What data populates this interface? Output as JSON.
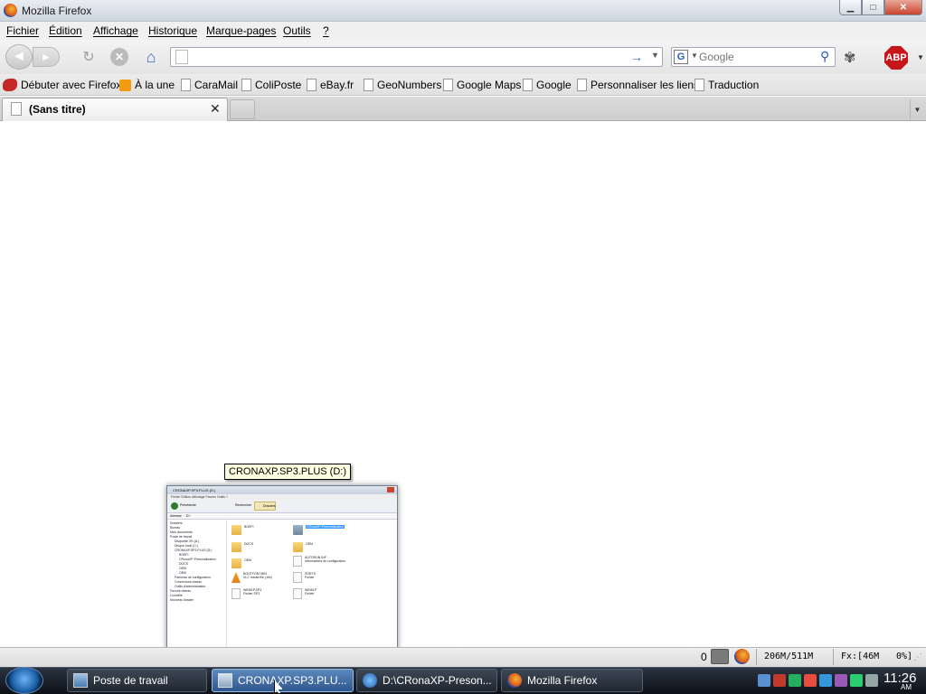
{
  "window": {
    "title": "Mozilla Firefox"
  },
  "menu": [
    "Fichier",
    "Édition",
    "Affichage",
    "Historique",
    "Marque-pages",
    "Outils",
    "?"
  ],
  "navbar": {
    "url": "",
    "search_placeholder": "Google",
    "adblock_label": "ABP"
  },
  "bookmarks": [
    "Débuter avec Firefox",
    "À la une",
    "CaraMail",
    "ColiPoste",
    "eBay.fr",
    "GeoNumbers",
    "Google Maps",
    "Google",
    "Personnaliser les liens",
    "Traduction"
  ],
  "tabs": [
    {
      "title": "(Sans titre)"
    }
  ],
  "tooltip": "CRONAXP.SP3.PLUS (D:)",
  "thumbnail": {
    "title": "CRONAXP.SP3.PLUS (D:)",
    "menu": "Fichier   Edition   Affichage   Favoris   Outils   ?",
    "address_label": "Adresse",
    "address_value": "D:\\",
    "toolbar_back": "Précédente",
    "toolbar_search": "Rechercher",
    "toolbar_folders": "Dossiers",
    "tree": [
      "Dossiers",
      "Bureau",
      "Mes documents",
      "Poste de travail",
      "Disquette 3½ (A:)",
      "Disque local (C:)",
      "CRONAXP.SP3.PLUS (D:)",
      "BOEFI",
      "CRonaXP-Presonalisation",
      "DOCS",
      "OEM",
      "OEM",
      "Panneau de configuration",
      "Connexions réseau",
      "Outils d'administration",
      "Favoris réseau",
      "Corbeille",
      "Nouveau dossier"
    ],
    "files": [
      {
        "name": "BOEFI",
        "type": "folder",
        "sub": ""
      },
      {
        "name": "CRonaXP-Presonalisation",
        "type": "folder-selected",
        "sub": ""
      },
      {
        "name": "DOCS",
        "type": "folder",
        "sub": ""
      },
      {
        "name": "OEM",
        "type": "folder",
        "sub": ""
      },
      {
        "name": "OEM",
        "type": "folder",
        "sub": ""
      },
      {
        "name": "AUTORUN.INF",
        "type": "doc",
        "sub": "Informations de configuration"
      },
      {
        "name": "BOOTFONT.BIN",
        "type": "vlc",
        "sub": "VLC media file (.bin)"
      },
      {
        "name": "SORTS",
        "type": "doc",
        "sub": "Fichier"
      },
      {
        "name": "WIN51P.SP3",
        "type": "doc",
        "sub": "Fichier SP3"
      },
      {
        "name": "WIN51P",
        "type": "doc",
        "sub": "Fichier"
      }
    ]
  },
  "statusbar": {
    "count": "0",
    "memory": "206M/511M",
    "fx": "Fx:[46M",
    "pct": "0%]"
  },
  "taskbar": {
    "items": [
      {
        "label": "Poste de travail",
        "active": false
      },
      {
        "label": "CRONAXP.SP3.PLU...",
        "active": true
      },
      {
        "label": "D:\\CRonaXP-Preson...",
        "active": false
      },
      {
        "label": "Mozilla Firefox",
        "active": false
      }
    ],
    "clock": "11:26",
    "ampm": "AM"
  },
  "colors": {
    "taskbar": "#0d1117",
    "active_task": "#2d578d",
    "abp": "#c8151b",
    "link_blue": "#3a6cc6"
  }
}
